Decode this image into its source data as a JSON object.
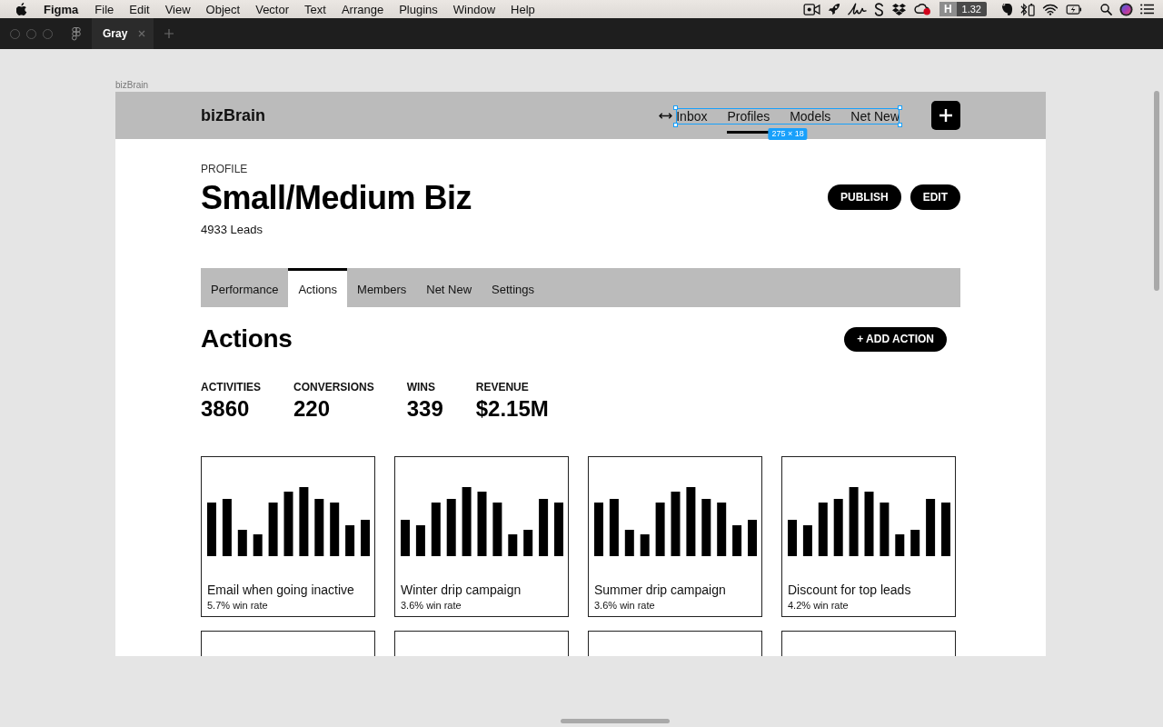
{
  "menu_bar": {
    "app_name": "Figma",
    "menus": [
      "File",
      "Edit",
      "View",
      "Object",
      "Vector",
      "Text",
      "Arrange",
      "Plugins",
      "Window",
      "Help"
    ],
    "status_badge": {
      "letter": "H",
      "value": "1.32"
    }
  },
  "tab_bar": {
    "tabs": [
      {
        "label": "Gray",
        "selected": true
      }
    ]
  },
  "canvas": {
    "frame_label": "bizBrain",
    "selection_size": "275 × 18",
    "frame": {
      "header": {
        "logo": "bizBrain",
        "nav": [
          {
            "label": "Inbox",
            "selected": false
          },
          {
            "label": "Profiles",
            "selected": true
          },
          {
            "label": "Models",
            "selected": false
          },
          {
            "label": "Net New",
            "selected": false
          }
        ]
      },
      "profile": {
        "eyebrow": "PROFILE",
        "title": "Small/Medium Biz",
        "subtitle": "4933 Leads",
        "buttons": [
          "PUBLISH",
          "EDIT"
        ]
      },
      "tabs": [
        {
          "label": "Performance",
          "selected": false
        },
        {
          "label": "Actions",
          "selected": true
        },
        {
          "label": "Members",
          "selected": false
        },
        {
          "label": "Net New",
          "selected": false
        },
        {
          "label": "Settings",
          "selected": false
        }
      ],
      "section": {
        "title": "Actions",
        "button": "+ ADD ACTION"
      },
      "stats": [
        {
          "label": "ACTIVITIES",
          "value": "3860"
        },
        {
          "label": "CONVERSIONS",
          "value": "220"
        },
        {
          "label": "WINS",
          "value": "339"
        },
        {
          "label": "REVENUE",
          "value": "$2.15M"
        }
      ],
      "cards": [
        {
          "kind": "action",
          "title": "Email when going inactive",
          "win_rate": "5.7% win rate"
        },
        {
          "kind": "action",
          "title": "Winter drip campaign",
          "win_rate": "3.6% win rate"
        },
        {
          "kind": "action",
          "title": "Summer drip campaign",
          "win_rate": "3.6% win rate"
        },
        {
          "kind": "action",
          "title": "Discount for top leads",
          "win_rate": "4.2% win rate"
        },
        {
          "kind": "clipped"
        },
        {
          "kind": "clipped"
        },
        {
          "kind": "clipped"
        },
        {
          "kind": "clipped"
        }
      ]
    }
  }
}
